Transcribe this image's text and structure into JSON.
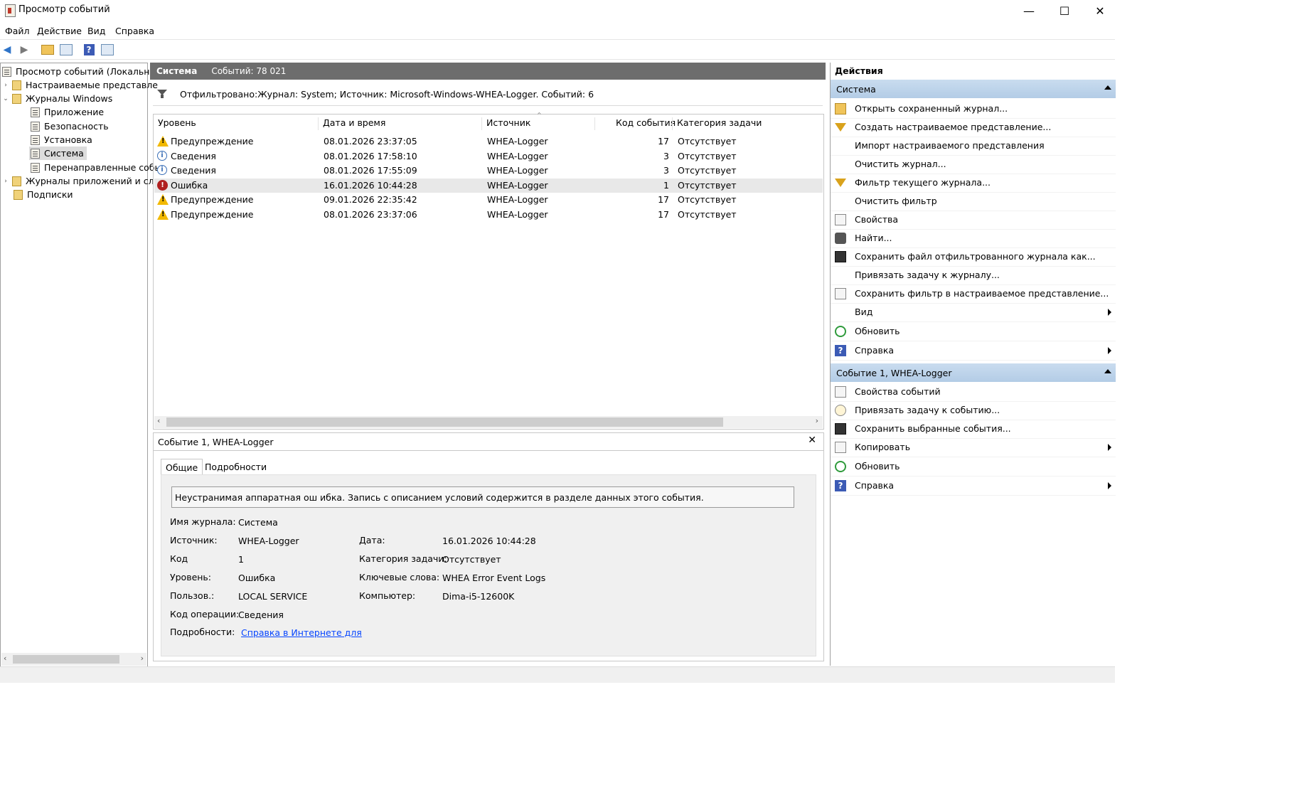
{
  "window": {
    "title": "Просмотр событий",
    "minimize": "—",
    "maximize": "☐",
    "close": "✕"
  },
  "menu": [
    "Файл",
    "Действие",
    "Вид",
    "Справка"
  ],
  "tree": {
    "root": "Просмотр событий (Локальный",
    "custom_views": "Настраиваемые представле",
    "windows_logs": "Журналы Windows",
    "application": "Приложение",
    "security": "Безопасность",
    "setup": "Установка",
    "system": "Система",
    "forwarded": "Перенаправленные собы",
    "app_services": "Журналы приложений и слу",
    "subscriptions": "Подписки"
  },
  "center": {
    "log_name": "Система",
    "count_label": "Событий: 78 021",
    "filter_text": "Отфильтровано:Журнал: System; Источник: Microsoft-Windows-WHEA-Logger. Событий: 6",
    "columns": [
      "Уровень",
      "Дата и время",
      "Источник",
      "Код события",
      "Категория задачи"
    ],
    "rows": [
      {
        "level": "Предупреждение",
        "icon": "warning-icon",
        "date": "08.01.2026 23:37:05",
        "source": "WHEA-Logger",
        "code": "17",
        "category": "Отсутствует"
      },
      {
        "level": "Сведения",
        "icon": "info-icon",
        "date": "08.01.2026 17:58:10",
        "source": "WHEA-Logger",
        "code": "3",
        "category": "Отсутствует"
      },
      {
        "level": "Сведения",
        "icon": "info-icon",
        "date": "08.01.2026 17:55:09",
        "source": "WHEA-Logger",
        "code": "3",
        "category": "Отсутствует"
      },
      {
        "level": "Ошибка",
        "icon": "error-icon",
        "date": "16.01.2026 10:44:28",
        "source": "WHEA-Logger",
        "code": "1",
        "category": "Отсутствует"
      },
      {
        "level": "Предупреждение",
        "icon": "warning-icon",
        "date": "09.01.2026 22:35:42",
        "source": "WHEA-Logger",
        "code": "17",
        "category": "Отсутствует"
      },
      {
        "level": "Предупреждение",
        "icon": "warning-icon",
        "date": "08.01.2026 23:37:06",
        "source": "WHEA-Logger",
        "code": "17",
        "category": "Отсутствует"
      }
    ],
    "selected_row": 3
  },
  "detail": {
    "title": "Событие 1, WHEA-Logger",
    "tab_general": "Общие",
    "tab_details": "Подробности",
    "description": "Неустранимая аппаратная ош ибка. Запись с описанием условий содержится в разделе данных этого события.",
    "labels": {
      "log": "Имя журнала:",
      "source": "Источник:",
      "code": "Код",
      "level": "Уровень:",
      "user": "Пользов.:",
      "opcode": "Код операции:",
      "more": "Подробности:",
      "date": "Дата:",
      "category": "Категория задачи:",
      "keywords": "Ключевые слова:",
      "computer": "Компьютер:"
    },
    "values": {
      "log": "Система",
      "source": "WHEA-Logger",
      "code": "1",
      "level": "Ошибка",
      "user": "LOCAL SERVICE",
      "opcode": "Сведения",
      "more_link": "Справка в Интернете для ",
      "date": "16.01.2026 10:44:28",
      "category": "Отсутствует",
      "keywords": "WHEA Error Event Logs",
      "computer": "Dima-i5-12600K"
    }
  },
  "actions": {
    "title": "Действия",
    "section1": "Система",
    "items1": [
      {
        "label": "Открыть сохраненный журнал...",
        "icon": "open-folder-icon",
        "submenu": false
      },
      {
        "label": "Создать настраиваемое представление...",
        "icon": "create-filter-icon",
        "submenu": false
      },
      {
        "label": "Импорт настраиваемого представления",
        "icon": "",
        "submenu": false
      },
      {
        "label": "Очистить журнал...",
        "icon": "",
        "submenu": false
      },
      {
        "label": "Фильтр текущего журнала...",
        "icon": "filter-icon",
        "submenu": false
      },
      {
        "label": "Очистить фильтр",
        "icon": "",
        "submenu": false
      },
      {
        "label": "Свойства",
        "icon": "properties-icon",
        "submenu": false
      },
      {
        "label": "Найти...",
        "icon": "find-icon",
        "submenu": false
      },
      {
        "label": "Сохранить файл отфильтрованного журнала как...",
        "icon": "save-icon",
        "submenu": false
      },
      {
        "label": "Привязать задачу к журналу...",
        "icon": "",
        "submenu": false
      },
      {
        "label": "Сохранить фильтр в настраиваемое представление...",
        "icon": "save-filter-icon",
        "submenu": false
      },
      {
        "label": "Вид",
        "icon": "",
        "submenu": true
      },
      {
        "label": "Обновить",
        "icon": "refresh-icon",
        "submenu": false
      },
      {
        "label": "Справка",
        "icon": "help-icon",
        "submenu": true
      }
    ],
    "section2": "Событие 1, WHEA-Logger",
    "items2": [
      {
        "label": "Свойства событий",
        "icon": "event-properties-icon",
        "submenu": false
      },
      {
        "label": "Привязать задачу к событию...",
        "icon": "task-icon",
        "submenu": false
      },
      {
        "label": "Сохранить выбранные события...",
        "icon": "save-icon",
        "submenu": false
      },
      {
        "label": "Копировать",
        "icon": "copy-icon",
        "submenu": true
      },
      {
        "label": "Обновить",
        "icon": "refresh-icon",
        "submenu": false
      },
      {
        "label": "Справка",
        "icon": "help-icon",
        "submenu": true
      }
    ]
  }
}
